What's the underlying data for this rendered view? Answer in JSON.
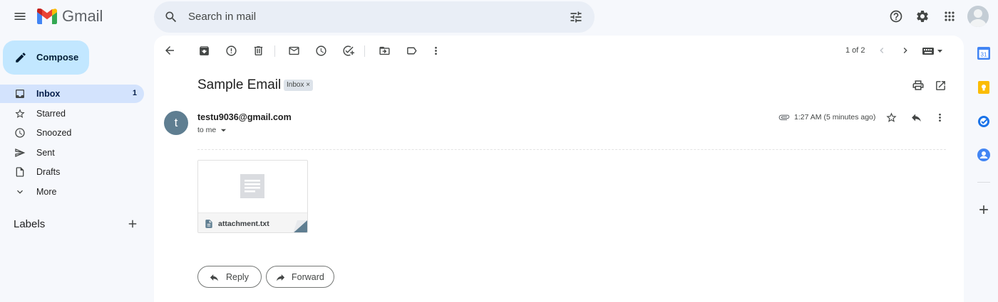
{
  "app": {
    "name": "Gmail",
    "brand_colors": {
      "red": "#ea4335",
      "blue": "#4285f4",
      "green": "#34a853",
      "yellow": "#fbbc04"
    }
  },
  "search": {
    "placeholder": "Search in mail"
  },
  "compose": {
    "label": "Compose"
  },
  "sidebar": {
    "items": [
      {
        "label": "Inbox",
        "count": "1",
        "icon": "inbox-icon",
        "active": true
      },
      {
        "label": "Starred",
        "icon": "star-icon"
      },
      {
        "label": "Snoozed",
        "icon": "clock-icon"
      },
      {
        "label": "Sent",
        "icon": "send-icon"
      },
      {
        "label": "Drafts",
        "icon": "draft-icon"
      },
      {
        "label": "More",
        "icon": "chevron-down-icon"
      }
    ],
    "labels_title": "Labels"
  },
  "toolbar": {
    "pager": "1 of 2"
  },
  "email": {
    "subject": "Sample Email",
    "tag": "Inbox",
    "avatar_letter": "t",
    "sender": "testu9036@gmail.com",
    "recipient": "to me",
    "time": "1:27 AM (5 minutes ago)",
    "attachment": {
      "name": "attachment.txt"
    }
  },
  "actions": {
    "reply": "Reply",
    "forward": "Forward"
  }
}
